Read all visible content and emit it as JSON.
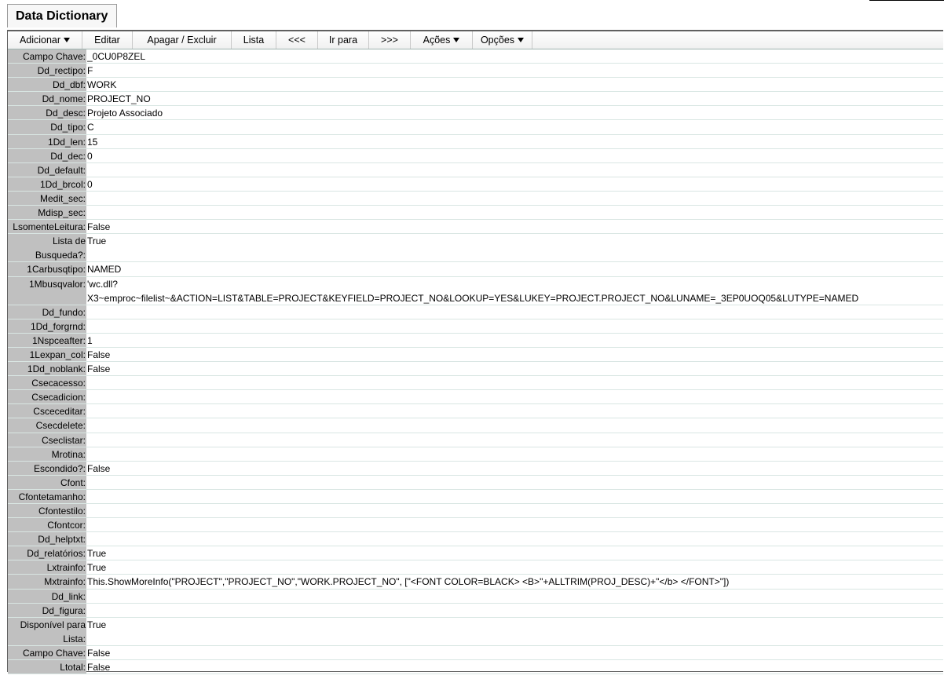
{
  "tab": {
    "title": "Data Dictionary"
  },
  "menu": {
    "items": [
      {
        "label": "Adicionar",
        "dropdown": true
      },
      {
        "label": "Editar",
        "dropdown": false
      },
      {
        "label": "Apagar / Excluir",
        "dropdown": false
      },
      {
        "label": "Lista",
        "dropdown": false
      },
      {
        "label": "<<<",
        "dropdown": false
      },
      {
        "label": "Ir para",
        "dropdown": false
      },
      {
        "label": ">>>",
        "dropdown": false
      },
      {
        "label": "Ações",
        "dropdown": true
      },
      {
        "label": "Opções",
        "dropdown": true
      }
    ]
  },
  "record": {
    "fields": [
      {
        "label": "Campo Chave",
        "value": "_0CU0P8ZEL"
      },
      {
        "label": "Dd_rectipo",
        "value": "F"
      },
      {
        "label": "Dd_dbf",
        "value": "WORK"
      },
      {
        "label": "Dd_nome",
        "value": "PROJECT_NO"
      },
      {
        "label": "Dd_desc",
        "value": "Projeto Associado"
      },
      {
        "label": "Dd_tipo",
        "value": "C"
      },
      {
        "label": "1Dd_len",
        "value": "15"
      },
      {
        "label": "Dd_dec",
        "value": "0"
      },
      {
        "label": "Dd_default",
        "value": ""
      },
      {
        "label": "1Dd_brcol",
        "value": "0"
      },
      {
        "label": "Medit_sec",
        "value": ""
      },
      {
        "label": "Mdisp_sec",
        "value": ""
      },
      {
        "label": "LsomenteLeitura",
        "value": "False"
      },
      {
        "label": "Lista de Busqueda?",
        "value": "True",
        "tall": true
      },
      {
        "label": "1Carbusqtipo",
        "value": "NAMED"
      },
      {
        "label": "1Mbusqvalor",
        "value": "'wc.dll?",
        "value2": "X3~emproc~filelist~&ACTION=LIST&TABLE=PROJECT&KEYFIELD=PROJECT_NO&LOOKUP=YES&LUKEY=PROJECT.PROJECT_NO&LUNAME=_3EP0UOQ05&LUTYPE=NAMED",
        "tall": true
      },
      {
        "label": "Dd_fundo",
        "value": ""
      },
      {
        "label": "1Dd_forgrnd",
        "value": ""
      },
      {
        "label": "1Nspceafter",
        "value": "1"
      },
      {
        "label": "1Lexpan_col",
        "value": "False"
      },
      {
        "label": "1Dd_noblank",
        "value": "False"
      },
      {
        "label": "Csecacesso",
        "value": ""
      },
      {
        "label": "Csecadicion",
        "value": ""
      },
      {
        "label": "Csceceditar",
        "value": ""
      },
      {
        "label": "Csecdelete",
        "value": ""
      },
      {
        "label": "Cseclistar",
        "value": ""
      },
      {
        "label": "Mrotina",
        "value": ""
      },
      {
        "label": "Escondido?",
        "value": "False"
      },
      {
        "label": "Cfont",
        "value": ""
      },
      {
        "label": "Cfontetamanho",
        "value": ""
      },
      {
        "label": "Cfontestilo",
        "value": ""
      },
      {
        "label": "Cfontcor",
        "value": ""
      },
      {
        "label": "Dd_helptxt",
        "value": ""
      },
      {
        "label": "Dd_relatórios",
        "value": "True"
      },
      {
        "label": "Lxtrainfo",
        "value": "True"
      },
      {
        "label": "Mxtrainfo",
        "value": "This.ShowMoreInfo(\"PROJECT\",\"PROJECT_NO\",\"WORK.PROJECT_NO\", [\"<FONT COLOR=BLACK> <B>\"+ALLTRIM(PROJ_DESC)+\"</b> </FONT>\"])"
      },
      {
        "label": "Dd_link",
        "value": ""
      },
      {
        "label": "Dd_figura",
        "value": ""
      },
      {
        "label": "Disponível para Lista",
        "value": "True",
        "tall": true
      },
      {
        "label": "Campo Chave",
        "value": "False"
      },
      {
        "label": "Ltotal",
        "value": "False"
      }
    ]
  }
}
